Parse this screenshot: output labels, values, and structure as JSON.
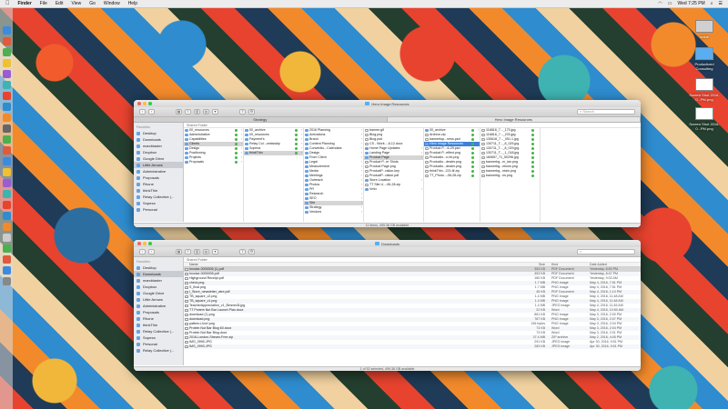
{
  "menubar": {
    "app": "Finder",
    "items": [
      "File",
      "Edit",
      "View",
      "Go",
      "Window",
      "Help"
    ],
    "clock": "Wed 7:25 PM"
  },
  "desktop_items": [
    {
      "label": "wilkie"
    },
    {
      "label": "Productized Consulting"
    },
    {
      "label": "Screen Shot 2016-0...PM.png"
    },
    {
      "label": "Screen Shot 2016-0...PM.png"
    }
  ],
  "window1": {
    "title": "Hero Image Resources",
    "search_placeholder": "Search",
    "tabs": [
      "Strategy",
      "Hero Image Resources"
    ],
    "section": "Shared Folder",
    "status": "11 items, 499.38 GB available",
    "sidebar": {
      "heading": "Favorites",
      "items": [
        "Desktop",
        "Downloads",
        "marcblaster",
        "Dropbox",
        "Google Drive",
        "Little Arrows",
        "Administrative",
        "Proposals",
        "Rhone",
        "thinkThin",
        "Relay Collective |...",
        "Sopexa",
        "Personal"
      ],
      "selected_index": 5
    },
    "col1": [
      "00_resources",
      "Administrative",
      "Capabilities",
      "Clients",
      "Design",
      "Positioning",
      "Projects",
      "Proposals"
    ],
    "col2": [
      "00_archive",
      "00_resources",
      "Payment's",
      "Relay Col...umbiosity",
      "Sopexa",
      "thinkThin"
    ],
    "col3": [
      "2016 Planning",
      "Activations",
      "Brand",
      "Content Planning",
      "Conventio...Calendars",
      "Design",
      "From Client",
      "Legal",
      "Measurement",
      "Media",
      "Meetings",
      "Outreach",
      "Photos",
      "PR",
      "Research",
      "SEO",
      "Site",
      "Strategy",
      "Vendors"
    ],
    "col4": [
      "banner.gif",
      "Blog.png",
      "Blog.psd",
      "CS - Work...-6-12.docx",
      "Home Page Updates",
      "Landing Page",
      "Product Page",
      "Product P...er Shots",
      "Product Page.png",
      "ProductP...ration.key",
      "ProductP...ration.pdf",
      "Store Location",
      "TT Site U...-06-28.zip",
      "Vmix"
    ],
    "col5": [
      "00_archive",
      "Archive.zip",
      "bannertop...ness.psd",
      "Hero Image Resources",
      "Product P...-6-29.psd",
      "Product P...effect.png",
      "Productio...n-hb.png",
      "Productio...dealer.png",
      "Productio...dealer.png",
      "thinkThin...221.tif.zip",
      "TT_Photo...-06-28.zip"
    ],
    "col6": [
      "116818_7..._170.jpg",
      "116818_7..._233.jpg",
      "130618_7..._051.1.jpg",
      "130711_T..._8_025.jpg",
      "130711_T..._8_029.jpg",
      "130711_T..._1_018.jpg",
      "160657_71_50296.jpg",
      "bannerbg...m_lan.png",
      "bannerbg...ntions.png",
      "bannerbg...ntain.png",
      "bannerbg...ns.png"
    ]
  },
  "window2": {
    "title": "Downloads",
    "section": "Shared Folder",
    "status": "1 of 52 selected, 499.38 GB available",
    "sidebar": {
      "heading": "Favorites",
      "items": [
        "Desktop",
        "Downloads",
        "marcblaster",
        "Dropbox",
        "Google Drive",
        "Little Arrows",
        "Administrative",
        "Proposals",
        "Rhone",
        "thinkThin",
        "Relay Collective |...",
        "Sopexa",
        "Personal",
        "Relay Collective |..."
      ],
      "selected_index": 1
    },
    "headers": {
      "name": "Name",
      "size": "Size",
      "kind": "Kind",
      "date": "Date Added"
    },
    "rows": [
      {
        "name": "Invoice-0000005 (1).pdf",
        "size": "353 KB",
        "kind": "PDF Document",
        "date": "Yesterday, 8:50 PM"
      },
      {
        "name": "Invoice-0000005.pdf",
        "size": "353 KB",
        "kind": "PDF Document",
        "date": "Yesterday, 8:47 PM"
      },
      {
        "name": "Highground Receipt.pdf",
        "size": "180 KB",
        "kind": "PDF Document",
        "date": "Yesterday, 9:02 AM"
      },
      {
        "name": "check.png",
        "size": "1.7 MB",
        "kind": "PNG image",
        "date": "May 4, 2016, 7:51 PM"
      },
      {
        "name": "S_final.png",
        "size": "1.7 MB",
        "kind": "PNG image",
        "date": "May 4, 2016, 7:51 PM"
      },
      {
        "name": "I_Store_newsletter_wire.pdf",
        "size": "45 KB",
        "kind": "PDF Document",
        "date": "May 4, 2016, 1:10 PM"
      },
      {
        "name": "TB_square_v2.png",
        "size": "1.4 MB",
        "kind": "PNG image",
        "date": "May 4, 2016, 11:48 AM"
      },
      {
        "name": "TB_square_v1.png",
        "size": "1.4 MB",
        "kind": "PNG image",
        "date": "May 4, 2016, 11:48 AM"
      },
      {
        "name": "TeacherAppreciation_v1_f5mmm3l.jpg",
        "size": "1.4 MB",
        "kind": "JPEG image",
        "date": "May 4, 2016, 11:45 AM"
      },
      {
        "name": "TT Protein Nut Bar Launch Plan.docx",
        "size": "22 KB",
        "kind": "Word",
        "date": "May 4, 2016, 10:50 AM"
      },
      {
        "name": "download (1).png",
        "size": "861 KB",
        "kind": "PNG image",
        "date": "May 3, 2016, 2:00 PM"
      },
      {
        "name": "download.png",
        "size": "787 KB",
        "kind": "PNG image",
        "date": "May 3, 2016, 2:07 PM"
      },
      {
        "name": "pattern-i-live!.png",
        "size": "196 bytes",
        "kind": "PNG image",
        "date": "May 3, 2016, 2:04 PM"
      },
      {
        "name": "Protein Nut Bar Blog 60.docx",
        "size": "73 KB",
        "kind": "Word",
        "date": "May 3, 2016, 2:04 PM"
      },
      {
        "name": "Protein Nut Bar Blog.docx",
        "size": "73 KB",
        "kind": "Word",
        "date": "May 3, 2016, 2:01 PM"
      },
      {
        "name": "2016-London-Stream-Free.zip",
        "size": "37.4 MB",
        "kind": "ZIP archive",
        "date": "May 2, 2016, 4:05 PM"
      },
      {
        "name": "IMG_0990.JPG",
        "size": "291 KB",
        "kind": "JPEG image",
        "date": "Apr 30, 2016, 9:51 PM"
      },
      {
        "name": "IMG_0993.JPG",
        "size": "283 KB",
        "kind": "JPEG image",
        "date": "Apr 30, 2016, 9:51 PM"
      }
    ]
  }
}
